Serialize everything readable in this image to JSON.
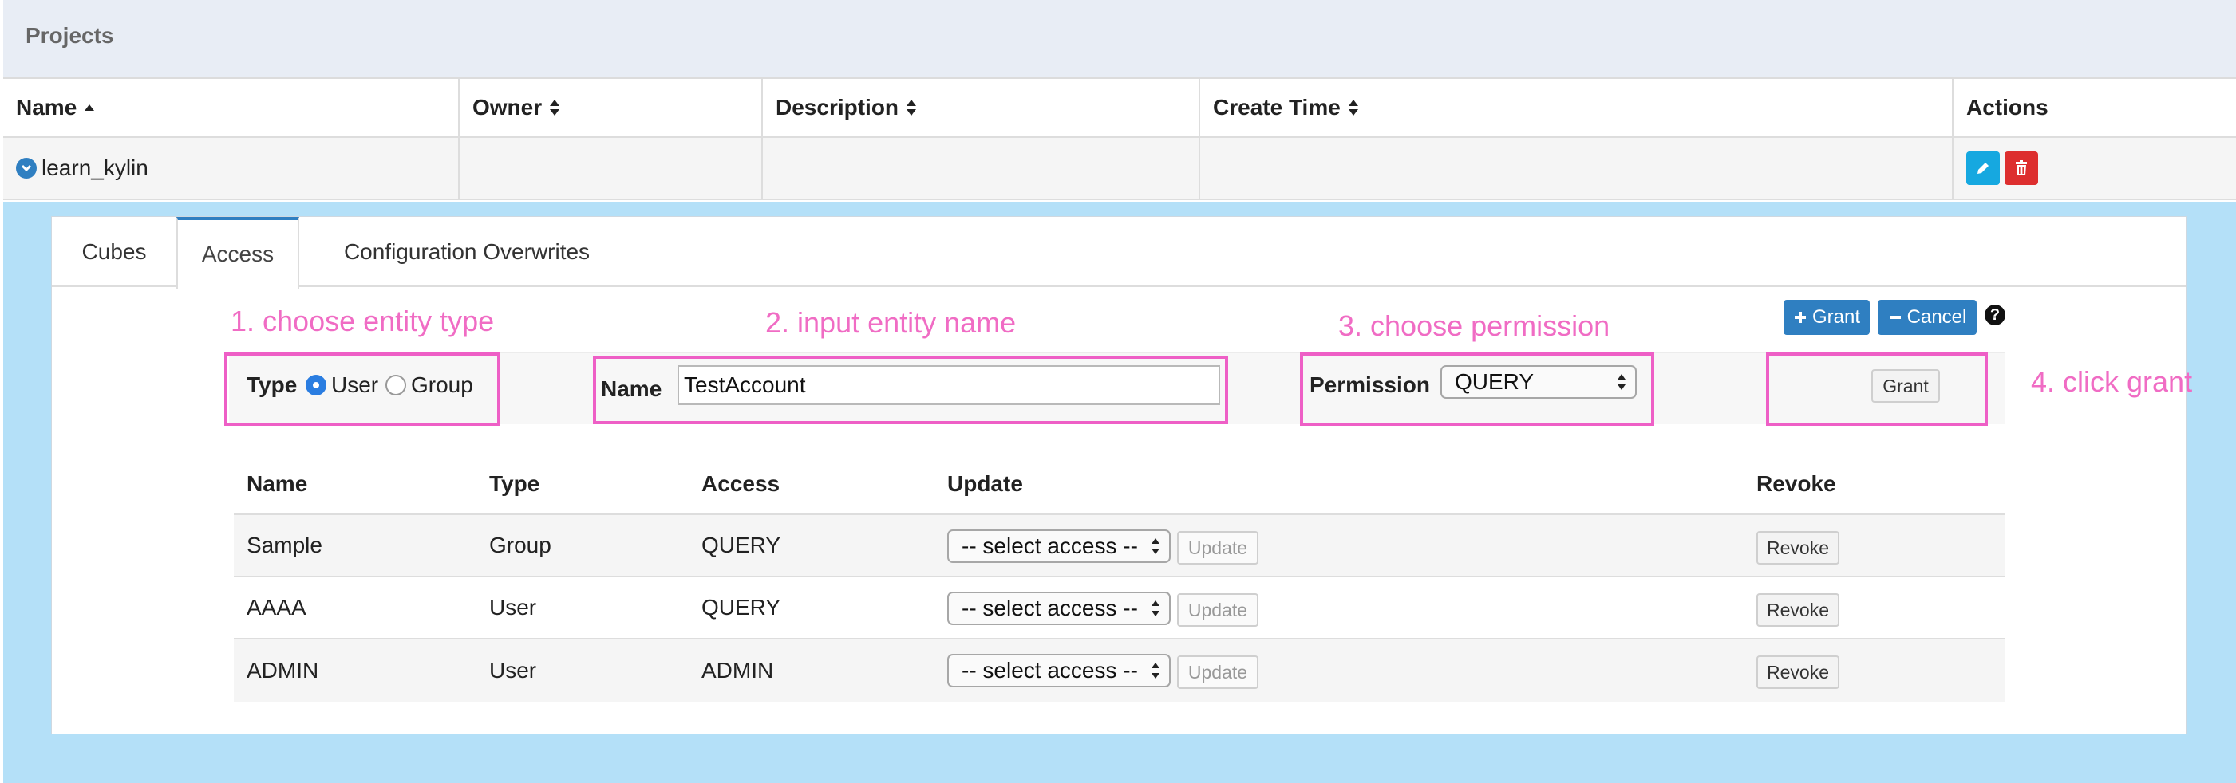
{
  "projects": {
    "title": "Projects",
    "columns": {
      "name": "Name",
      "owner": "Owner",
      "description": "Description",
      "create_time": "Create Time",
      "actions": "Actions"
    },
    "row": {
      "name": "learn_kylin",
      "owner": "",
      "description": "",
      "create_time": ""
    }
  },
  "tabs": [
    {
      "label": "Cubes"
    },
    {
      "label": "Access"
    },
    {
      "label": "Configuration Overwrites"
    }
  ],
  "annotations": {
    "step1": "1. choose entity type",
    "step2": "2. input entity name",
    "step3": "3. choose permission",
    "step4": "4. click grant"
  },
  "grant_form": {
    "type_label": "Type",
    "type_options": [
      "User",
      "Group"
    ],
    "type_selected": "User",
    "name_label": "Name",
    "name_value": "TestAccount",
    "permission_label": "Permission",
    "permission_value": "QUERY",
    "grant_button": "Grant",
    "top_grant_button": "Grant",
    "top_cancel_button": "Cancel"
  },
  "access_table": {
    "columns": {
      "name": "Name",
      "type": "Type",
      "access": "Access",
      "update": "Update",
      "revoke": "Revoke"
    },
    "rows": [
      {
        "name": "Sample",
        "type": "Group",
        "access": "QUERY",
        "select": "-- select access --",
        "update": "Update",
        "revoke": "Revoke"
      },
      {
        "name": "AAAA",
        "type": "User",
        "access": "QUERY",
        "select": "-- select access --",
        "update": "Update",
        "revoke": "Revoke"
      },
      {
        "name": "ADMIN",
        "type": "User",
        "access": "ADMIN",
        "select": "-- select access --",
        "update": "Update",
        "revoke": "Revoke"
      }
    ]
  },
  "colors": {
    "accent": "#2f7fc1",
    "annotation": "#f06cc4",
    "expanded_bg": "#b4e0f8",
    "delete": "#dd2e2e",
    "edit": "#16a8e0"
  }
}
